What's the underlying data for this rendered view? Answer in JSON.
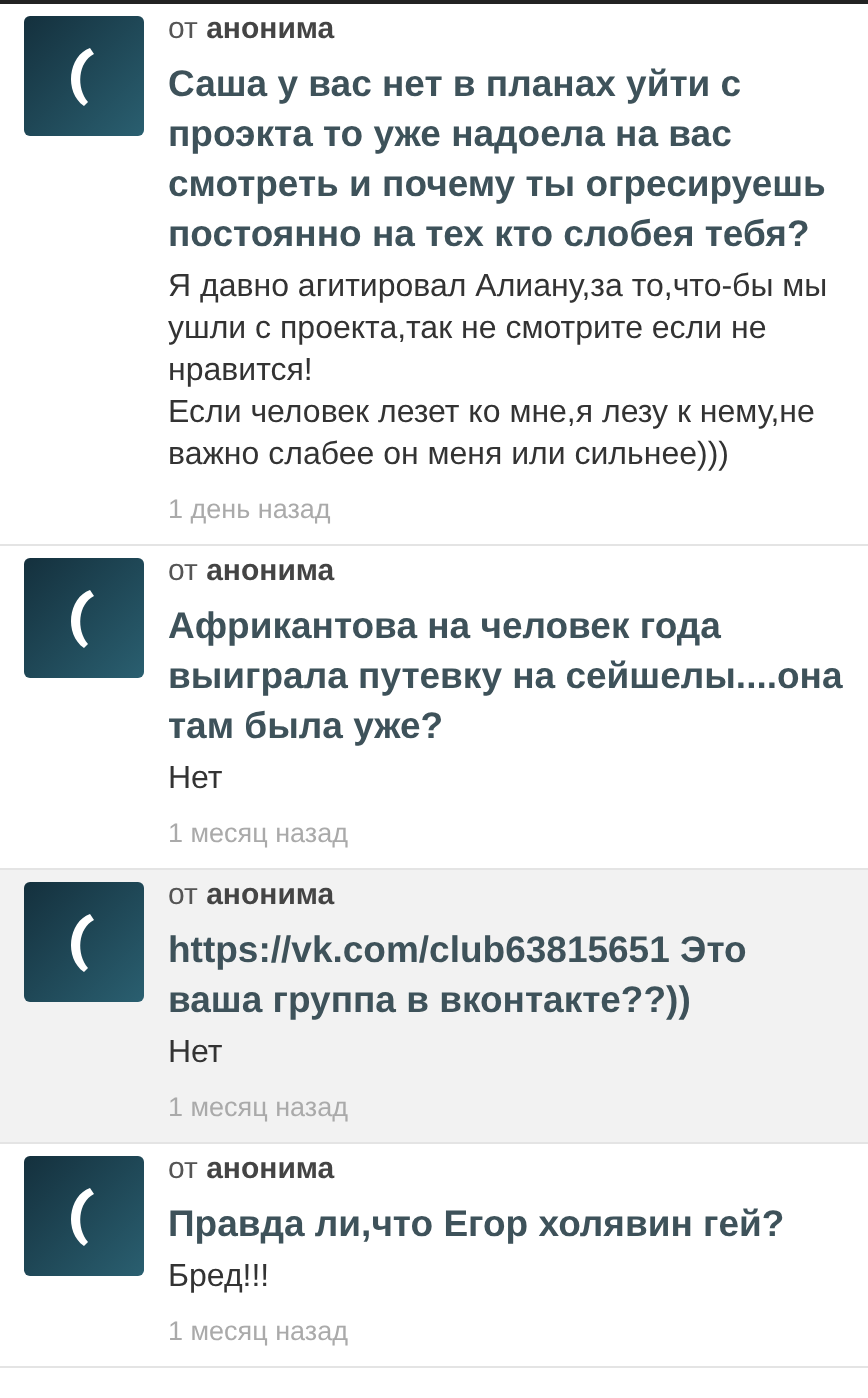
{
  "answers": [
    {
      "from": "от **анонима**",
      "question": "Саша у вас нет в планах уйти с проэкта то уже надоела на вас смотреть и почему ты огресируешь постоянно на тех кто слобея тебя?",
      "answer": "Я давно агитировал Алиану,за то,что-бы мы ушли с проекта,так не смотрите если не нравится!\nЕсли человек лезет ко мне,я лезу к нему,не важно слабее он меня или сильнее)))",
      "time": "1 день назад",
      "selected": false
    },
    {
      "from": "от **анонима**",
      "question": "Африкантова на человек года выиграла путевку на сейшелы....она там была уже?",
      "answer": "Нет",
      "time": "1 месяц назад",
      "selected": false
    },
    {
      "from": "от **анонима**",
      "question": "https://vk.com/club63815651 Это ваша группа в вконтакте??))",
      "answer": "Нет",
      "time": "1 месяц назад",
      "selected": true
    },
    {
      "from": "от **анонима**",
      "question": "Правда ли,что Егор холявин гей?",
      "answer": "Бред!!!",
      "time": "1 месяц назад",
      "selected": false
    }
  ]
}
